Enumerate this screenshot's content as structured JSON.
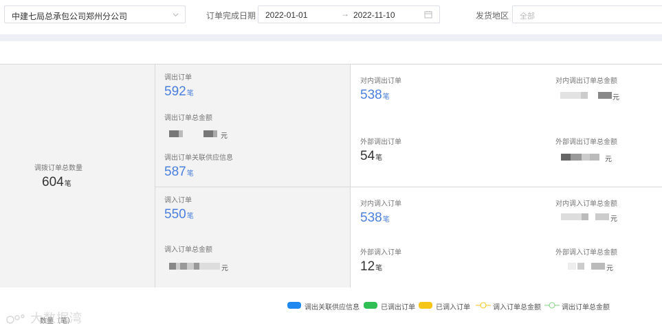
{
  "filters": {
    "company": "中建七局总承包公司郑州分公司",
    "date_label": "订单完成日期",
    "date_start": "2022-01-01",
    "date_sep": "→",
    "date_end": "2022-11-10",
    "region_label": "发货地区",
    "region_placeholder": "全部"
  },
  "stats": {
    "total": {
      "label": "调拨订单总数量",
      "value": "604",
      "unit": "笔"
    },
    "out": {
      "orders_label": "调出订单",
      "orders_value": "592",
      "orders_unit": "笔",
      "amount_label": "调出订单总金额",
      "amount_unit": "元",
      "supplier_label": "调出订单关联供应信息",
      "supplier_value": "587",
      "supplier_unit": "笔",
      "internal_label": "对内调出订单",
      "internal_value": "538",
      "internal_unit": "笔",
      "internal_amount_label": "对内调出订单总金额",
      "internal_amount_unit": "元",
      "external_label": "外部调出订单",
      "external_value": "54",
      "external_unit": "笔",
      "external_amount_label": "外部调出订单总金额",
      "external_amount_unit": "元"
    },
    "in": {
      "orders_label": "调入订单",
      "orders_value": "550",
      "orders_unit": "笔",
      "amount_label": "调入订单总金额",
      "amount_unit": "元",
      "internal_label": "对内调入订单",
      "internal_value": "538",
      "internal_unit": "笔",
      "internal_amount_label": "对内调入订单总金额",
      "internal_amount_unit": "元",
      "external_label": "外部调入订单",
      "external_value": "12",
      "external_unit": "笔",
      "external_amount_label": "外部调入订单总金额",
      "external_amount_unit": "元"
    }
  },
  "legend": [
    {
      "label": "调出关联供应信息",
      "color": "#1e88f0",
      "kind": "bar"
    },
    {
      "label": "已调出订单",
      "color": "#2fbf55",
      "kind": "bar"
    },
    {
      "label": "已调入订单",
      "color": "#f5c518",
      "kind": "bar"
    },
    {
      "label": "调入订单总金额",
      "color": "#f5c518",
      "kind": "line"
    },
    {
      "label": "调出订单总金额",
      "color": "#7fd07f",
      "kind": "line"
    }
  ],
  "chart": {
    "y_axis_name": "数量（笔）"
  },
  "watermark": "大数据湾",
  "icons": {
    "dropdown": "chevron-down-icon",
    "calendar": "calendar-icon"
  }
}
